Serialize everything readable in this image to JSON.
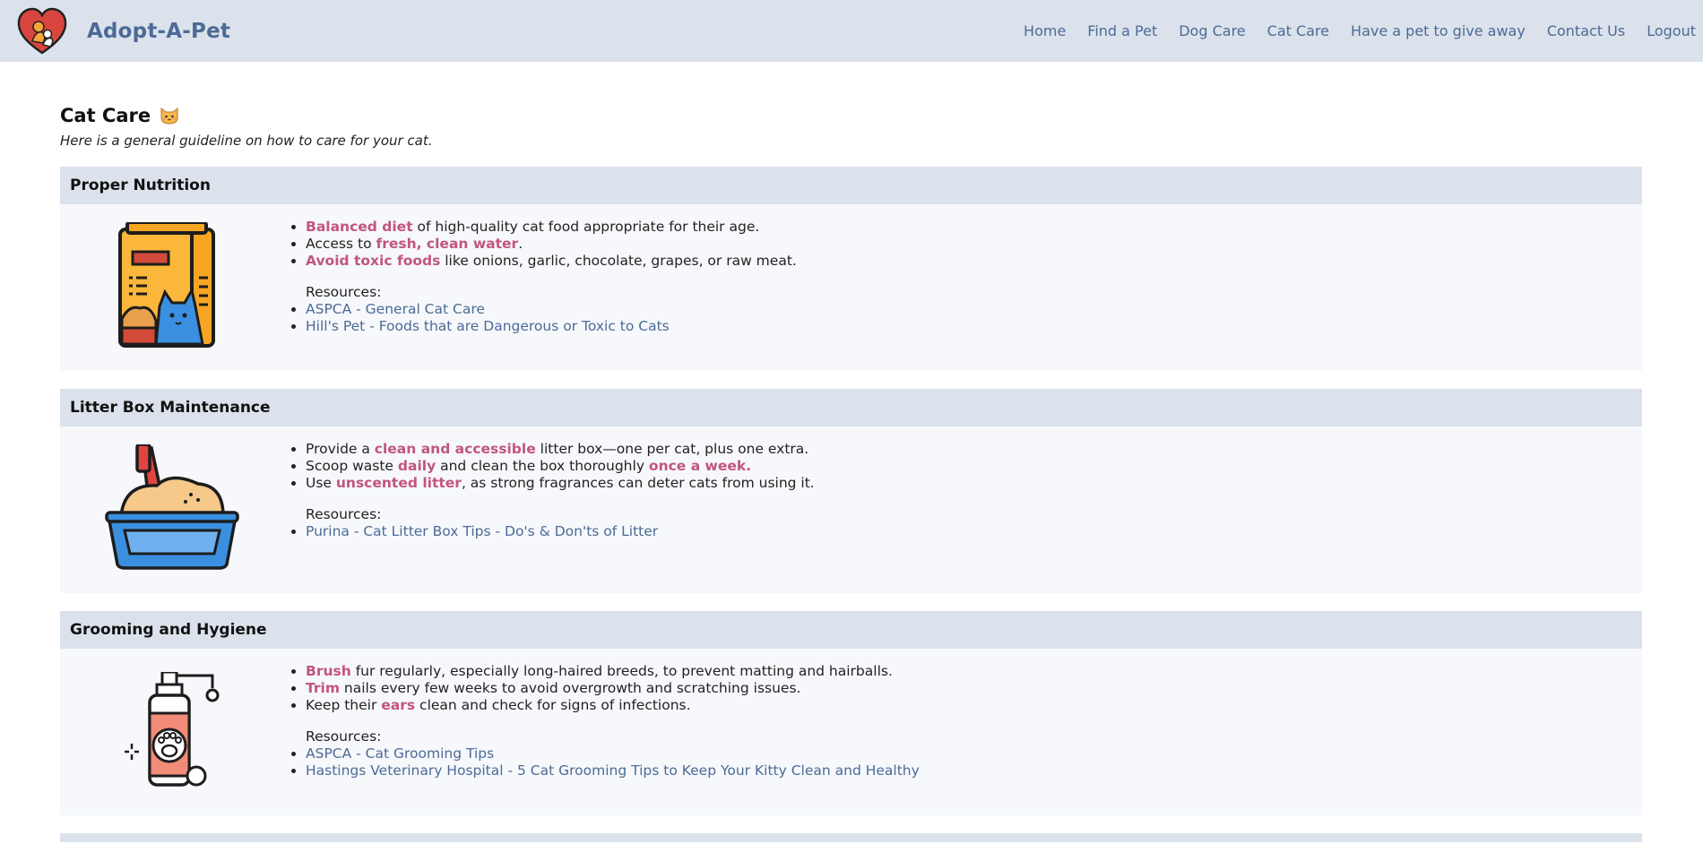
{
  "brand": {
    "name": "Adopt-A-Pet"
  },
  "nav": [
    "Home",
    "Find a Pet",
    "Dog Care",
    "Cat Care",
    "Have a pet to give away",
    "Contact Us",
    "Logout"
  ],
  "page": {
    "title": "Cat Care",
    "subtitle": "Here is a general guideline on how to care for your cat."
  },
  "sections": [
    {
      "title": "Proper Nutrition",
      "icon": "cat-food-bag-icon",
      "bullets": [
        {
          "highlight": "Balanced diet",
          "rest": " of high-quality cat food appropriate for their age."
        },
        {
          "pre": "Access to ",
          "highlight": "fresh, clean water",
          "rest": "."
        },
        {
          "highlight": "Avoid toxic foods",
          "rest": " like onions, garlic, chocolate, grapes, or raw meat."
        }
      ],
      "resources_label": "Resources:",
      "links": [
        "ASPCA - General Cat Care",
        "Hill's Pet - Foods that are Dangerous or Toxic to Cats"
      ]
    },
    {
      "title": "Litter Box Maintenance",
      "icon": "litter-box-icon",
      "bullets": [
        {
          "pre": "Provide a ",
          "highlight": "clean and accessible",
          "rest": " litter box—one per cat, plus one extra."
        },
        {
          "pre": "Scoop waste ",
          "highlight": "daily",
          "mid": " and clean the box thoroughly ",
          "highlight2": "once a week",
          "rest": "."
        },
        {
          "pre": "Use ",
          "highlight": "unscented litter",
          "rest": ", as strong fragrances can deter cats from using it."
        }
      ],
      "resources_label": "Resources:",
      "links": [
        "Purina - Cat Litter Box Tips - Do's & Don'ts of Litter"
      ]
    },
    {
      "title": "Grooming and Hygiene",
      "icon": "pet-shampoo-icon",
      "bullets": [
        {
          "highlight": "Brush",
          "rest": " fur regularly, especially long-haired breeds, to prevent matting and hairballs."
        },
        {
          "highlight": "Trim",
          "rest": " nails every few weeks to avoid overgrowth and scratching issues."
        },
        {
          "pre": "Keep their ",
          "highlight": "ears",
          "rest": " clean and check for signs of infections."
        }
      ],
      "resources_label": "Resources:",
      "links": [
        "ASPCA - Cat Grooming Tips",
        "Hastings Veterinary Hospital - 5 Cat Grooming Tips to Keep Your Kitty Clean and Healthy"
      ]
    }
  ],
  "colors": {
    "navbar": "#dbe2ec",
    "brand": "#4d6a96",
    "highlight": "#c2557f",
    "link": "#4d6a96",
    "section_body": "#f6f8fb"
  }
}
